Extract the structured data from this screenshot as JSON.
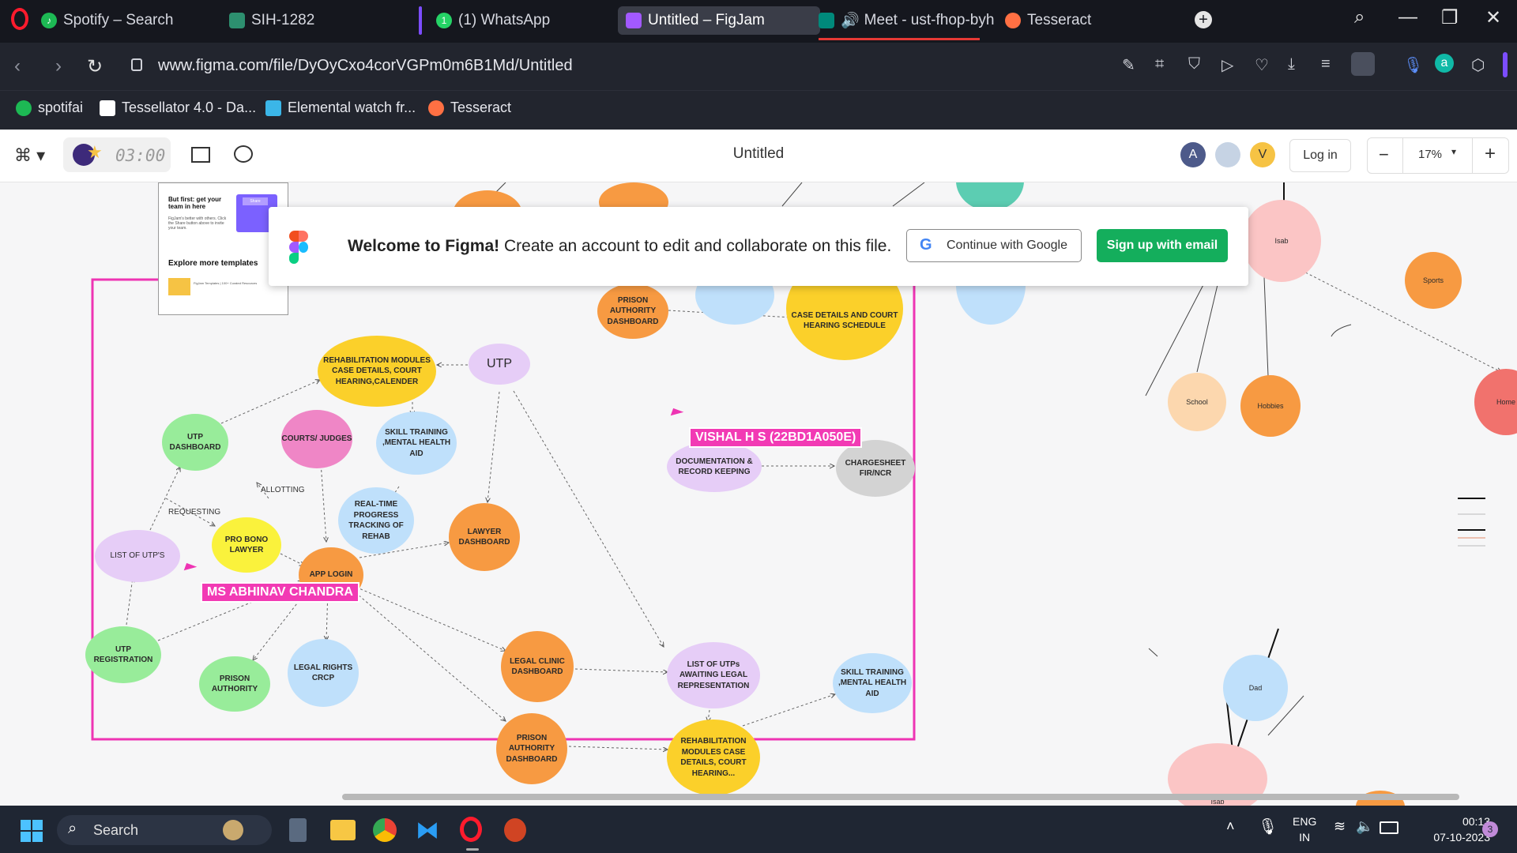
{
  "browser": {
    "tabs": [
      {
        "label": "Spotify – Search",
        "color": "#1db954"
      },
      {
        "label": "SIH-1282",
        "color": "#2d8f6f"
      },
      {
        "label": "(1) WhatsApp",
        "color": "#25d366"
      },
      {
        "label": "Untitled – FigJam",
        "color": "#a259ff"
      },
      {
        "label": "Meet - ust-fhop-byh",
        "color": "#00897b"
      },
      {
        "label": "Tesseract",
        "color": "#ff7043"
      }
    ],
    "url": "www.figma.com/file/DyOyCxo4corVGPm0m6B1Md/Untitled",
    "bookmarks": [
      {
        "label": "spotifai",
        "color": "#1db954"
      },
      {
        "label": "Tessellator 4.0 - Da...",
        "color": "#ffffff"
      },
      {
        "label": "Elemental watch fr...",
        "color": "#3bb6e8"
      },
      {
        "label": "Tesseract",
        "color": "#ff7043"
      }
    ]
  },
  "figma": {
    "timer": "03:00",
    "file_title": "Untitled",
    "avatars": [
      "A",
      "V"
    ],
    "login_label": "Log in",
    "zoom": "17%",
    "zoom_minus": "−",
    "zoom_plus": "+"
  },
  "banner": {
    "welcome_bold": "Welcome to Figma!",
    "welcome_rest": "Create an account to edit and collaborate on this file.",
    "google_button": "Continue with Google",
    "email_button": "Sign up with email"
  },
  "template_panel": {
    "title": "But first: get your team in here",
    "body": "FigJam's better with others. Click the Share button above to invite your team.",
    "share": "Share",
    "explore": "Explore more templates",
    "item": "FigJam Templates | 100+ Curated Resources"
  },
  "nodes": {
    "rehab_top": "REHABILITATION MODULES CASE DETAILS, COURT HEARING,CALENDER",
    "utp": "UTP",
    "utp_dashboard": "UTP DASHBOARD",
    "courts_judges": "COURTS/ JUDGES",
    "skill_training_top": "SKILL TRAINING ,MENTAL HEALTH AID",
    "documentation": "DOCUMENTATION & RECORD KEEPING",
    "chargesheet": "CHARGESHEET FIR/NCR",
    "realtime": "REAL-TIME PROGRESS TRACKING OF REHAB",
    "lawyer_dashboard": "LAWYER DASHBOARD",
    "list_utps": "LIST OF UTP'S",
    "pro_bono": "PRO BONO LAWYER",
    "app_login": "APP LOGIN",
    "utp_registration": "UTP REGISTRATION",
    "prison_authority": "PRISON AUTHORITY",
    "legal_rights": "LEGAL RIGHTS CRCP",
    "legal_clinic": "LEGAL CLINIC DASHBOARD",
    "list_awaiting": "LIST OF UTPs AWAITING LEGAL REPRESENTATION",
    "skill_training_bottom": "SKILL TRAINING ,MENTAL HEALTH AID",
    "prison_dashboard": "PRISON AUTHORITY DASHBOARD",
    "rehab_bottom": "REHABILITATION MODULES CASE DETAILS, COURT HEARING...",
    "prison_dashboard_top": "PRISON AUTHORITY DASHBOARD",
    "case_details_top": "CASE DETAILS AND COURT HEARING SCHEDULE",
    "isab": "Isab",
    "sports": "Sports",
    "school": "School",
    "hobbies": "Hobbies",
    "home": "Home",
    "dad": "Dad",
    "isab_bottom": "Isab"
  },
  "edge_labels": {
    "allotting": "ALLOTTING",
    "requesting": "REQUESTING"
  },
  "cursors": {
    "vishal": "VISHAL H S (22BD1A050E)",
    "abhinav": "MS ABHINAV CHANDRA"
  },
  "taskbar": {
    "search": "Search",
    "lang": "ENG",
    "region": "IN",
    "time": "00:13",
    "date": "07-10-2023",
    "notifications": "3"
  }
}
